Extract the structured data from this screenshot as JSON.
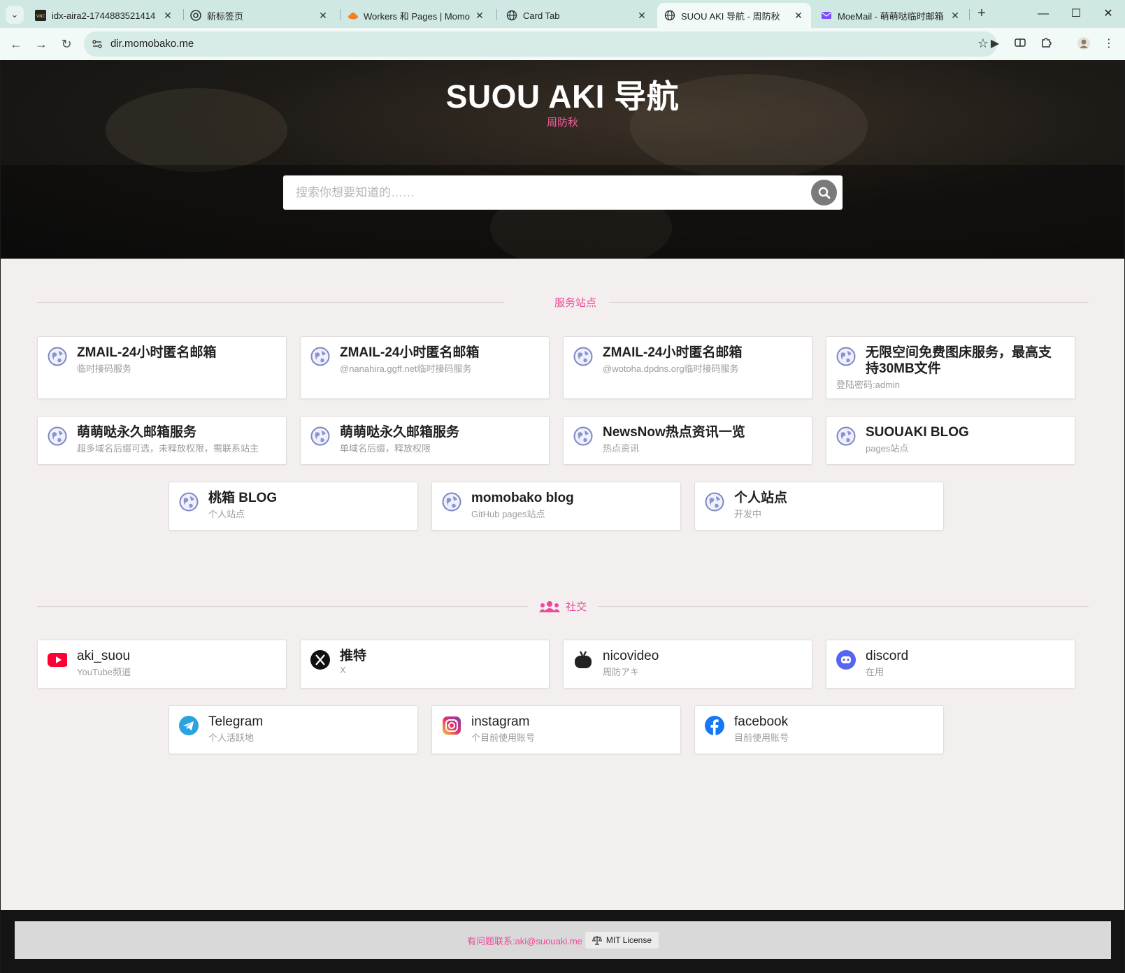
{
  "browser": {
    "tabs": [
      {
        "title": "idx-aira2-1744883521414",
        "favicon": "vnc-icon"
      },
      {
        "title": "新标签页",
        "favicon": "chrome-icon"
      },
      {
        "title": "Workers 和 Pages | Momob",
        "favicon": "cloudflare-icon"
      },
      {
        "title": "Card Tab",
        "favicon": "globe-icon"
      },
      {
        "title": "SUOU AKI 导航 - 周防秋",
        "favicon": "globe-icon",
        "active": true
      },
      {
        "title": "MoeMail - 萌萌哒临时邮箱",
        "favicon": "moemail-icon"
      }
    ],
    "url": "dir.momobako.me"
  },
  "hero": {
    "title": "SUOU AKI 导航",
    "subtitle": "周防秋",
    "search_placeholder": "搜索你想要知道的……"
  },
  "sections": [
    {
      "label": "服务站点",
      "cards": [
        {
          "title": "ZMAIL-24小时匿名邮箱",
          "desc": "临时接码服务",
          "icon": "globe-icon"
        },
        {
          "title": "ZMAIL-24小时匿名邮箱",
          "desc": "@nanahira.ggff.net临时接码服务",
          "icon": "globe-icon"
        },
        {
          "title": "ZMAIL-24小时匿名邮箱",
          "desc": "@wotoha.dpdns.org临时接码服务",
          "icon": "globe-icon"
        },
        {
          "title": "无限空间免费图床服务，最高支持30MB文件",
          "desc": "登陆密码:admin",
          "icon": "globe-icon"
        },
        {
          "title": "萌萌哒永久邮箱服务",
          "desc": "超多域名后缀可选，未释放权限，需联系站主",
          "icon": "globe-icon"
        },
        {
          "title": "萌萌哒永久邮箱服务",
          "desc": "单域名后缀，释放权限",
          "icon": "globe-icon"
        },
        {
          "title": "NewsNow热点资讯一览",
          "desc": "热点资讯",
          "icon": "globe-icon"
        },
        {
          "title": "SUOUAKI BLOG",
          "desc": "pages站点",
          "icon": "globe-icon"
        },
        {
          "title": "桃箱 BLOG",
          "desc": "个人站点",
          "icon": "globe-icon"
        },
        {
          "title": "momobako blog",
          "desc": "GitHub pages站点",
          "icon": "globe-icon"
        },
        {
          "title": "个人站点",
          "desc": "开发中",
          "icon": "globe-icon"
        }
      ]
    },
    {
      "label": "社交",
      "icon": "users-icon",
      "cards": [
        {
          "title": "aki_suou",
          "desc": "YouTube频道",
          "icon": "youtube-icon"
        },
        {
          "title": "推特",
          "desc": "X",
          "icon": "x-icon"
        },
        {
          "title": "nicovideo",
          "desc": "周防アキ",
          "icon": "nicovideo-icon"
        },
        {
          "title": "discord",
          "desc": "在用",
          "icon": "discord-icon"
        },
        {
          "title": "Telegram",
          "desc": "个人活跃地",
          "icon": "telegram-icon"
        },
        {
          "title": "instagram",
          "desc": "个目前使用账号",
          "icon": "instagram-icon"
        },
        {
          "title": "facebook",
          "desc": "目前使用账号",
          "icon": "facebook-icon"
        }
      ]
    }
  ],
  "footer": {
    "contact": "有问题联系:aki@suouaki.me",
    "license": "MIT License"
  },
  "colors": {
    "accent": "#f0479b",
    "page_bg": "#f3efee",
    "card_bg": "#ffffff"
  }
}
